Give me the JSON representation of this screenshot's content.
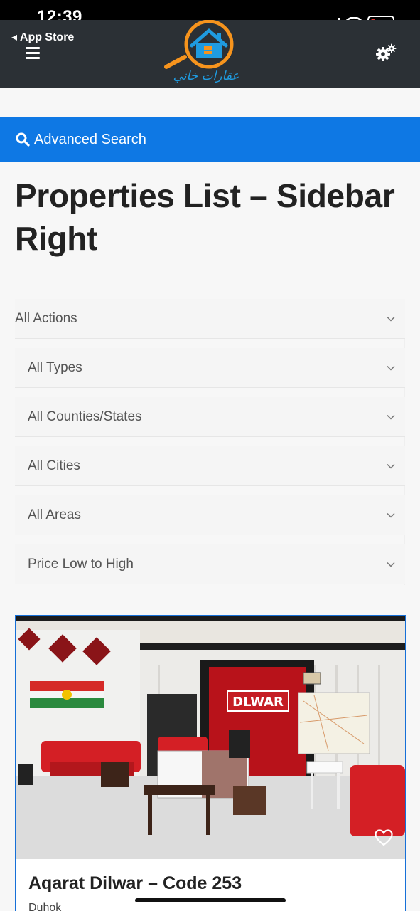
{
  "status": {
    "time": "12:39"
  },
  "header": {
    "back_label": "◂ App Store",
    "logo_text": "عقارات خاني"
  },
  "search": {
    "label": "Advanced Search"
  },
  "page": {
    "title": "Properties List – Sidebar Right"
  },
  "filters": {
    "actions": "All Actions",
    "types": "All Types",
    "counties": "All Counties/States",
    "cities": "All Cities",
    "areas": "All Areas",
    "sort": "Price Low to High"
  },
  "card": {
    "photo_sign": "DLWAR",
    "title": "Aqarat Dilwar – Code 253",
    "location": "Duhok"
  },
  "colors": {
    "accent": "#0e78e4",
    "header_bg": "#2b3035",
    "logo_orange": "#f7941d",
    "logo_blue": "#1f9be0"
  },
  "icons": [
    "menu-icon",
    "gear-icon",
    "search-icon",
    "chevron-down-icon",
    "heart-icon",
    "wifi-icon",
    "battery-icon"
  ]
}
